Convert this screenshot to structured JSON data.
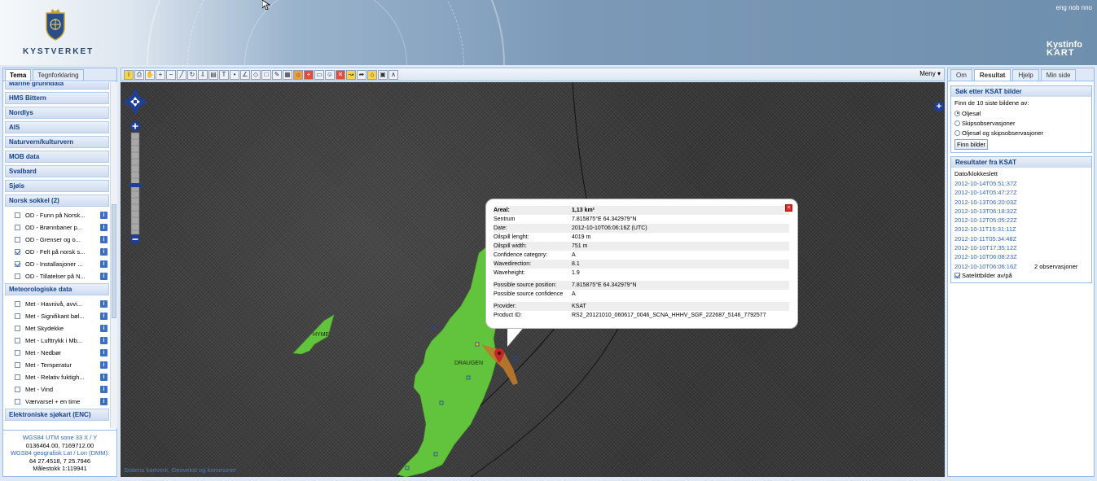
{
  "header": {
    "logo_text": "KYSTVERKET",
    "lang_links": "eng nob nno",
    "brand_line1": "Kystinfo",
    "brand_line2": "KART"
  },
  "left_panel": {
    "tabs": [
      "Tema",
      "Tegnforklaring"
    ],
    "groups": [
      {
        "label": "Marine grunndata",
        "items": []
      },
      {
        "label": "HMS Bittern",
        "items": []
      },
      {
        "label": "Nordlys",
        "items": []
      },
      {
        "label": "AIS",
        "items": []
      },
      {
        "label": "Naturvern/kulturvern",
        "items": []
      },
      {
        "label": "MOB data",
        "items": []
      },
      {
        "label": "Svalbard",
        "items": []
      },
      {
        "label": "Sjøis",
        "items": []
      },
      {
        "label": "Norsk sokkel (2)",
        "items": [
          {
            "label": "OD - Funn på Norsk...",
            "checked": false
          },
          {
            "label": "OD - Brønnbaner p...",
            "checked": false
          },
          {
            "label": "OD - Grenser og o...",
            "checked": false
          },
          {
            "label": "OD - Felt på norsk s...",
            "checked": true
          },
          {
            "label": "OD - Installasjoner ...",
            "checked": true
          },
          {
            "label": "OD - Tillatelser på N...",
            "checked": false
          }
        ]
      },
      {
        "label": "Meteorologiske data",
        "items": [
          {
            "label": "Met - Havnivå, avvi...",
            "checked": false
          },
          {
            "label": "Met - Signifikant bøl...",
            "checked": false
          },
          {
            "label": "Met Skydekke",
            "checked": false
          },
          {
            "label": "Met - Lufttrykk i Mb...",
            "checked": false
          },
          {
            "label": "Met - Nedbør",
            "checked": false
          },
          {
            "label": "Met - Temperatur",
            "checked": false
          },
          {
            "label": "Met - Relativ fuktigh...",
            "checked": false
          },
          {
            "label": "Met - Vind",
            "checked": false
          },
          {
            "label": "Værvarsel + en time",
            "checked": false
          }
        ]
      },
      {
        "label": "Elektroniske sjøkart (ENC)",
        "items": []
      }
    ],
    "coords": {
      "utm_label": "WGS84 UTM sone 33 X / Y",
      "utm_value": "0136464.00, 7169712.00",
      "geo_label": "WGS84 geografisk Lat / Lon (DMM):",
      "geo_value": "64 27.4518, 7 25.7946",
      "scale": "Målestokk 1:119941"
    }
  },
  "toolbar": {
    "meny_label": "Meny"
  },
  "map": {
    "labels": {
      "hyme": "HYME",
      "draugen": "DRAUGEN"
    },
    "credits": "Statens kartverk, Geovekst og kommuner",
    "popup": {
      "rows": [
        {
          "k": "Areal:",
          "v": "1,13 km²"
        },
        {
          "k": "Sentrum",
          "v": "7.815875°E 64.342979°N"
        },
        {
          "k": "Date:",
          "v": "2012-10-10T06:06:16Z (UTC)"
        },
        {
          "k": "Oilspill lenght:",
          "v": "4019 m"
        },
        {
          "k": "Oilspill width:",
          "v": "751 m"
        },
        {
          "k": "Confidence category:",
          "v": "A"
        },
        {
          "k": "Wavedirection:",
          "v": "8.1"
        },
        {
          "k": "Waveheight:",
          "v": "1.9"
        }
      ],
      "rows2": [
        {
          "k": "Possible source position:",
          "v": "7.815875°E 64.342979°N"
        },
        {
          "k": "Possible source confidence",
          "v": "A"
        }
      ],
      "rows3": [
        {
          "k": "Provider:",
          "v": "KSAT"
        },
        {
          "k": "Product ID:",
          "v": "RS2_20121010_060617_0046_SCNA_HHHV_SGF_222687_5146_7792577"
        }
      ]
    }
  },
  "right_panel": {
    "tabs": [
      "Om",
      "Resultat",
      "Hjelp",
      "Min side"
    ],
    "search": {
      "title": "Søk etter KSAT bilder",
      "intro": "Finn de 10 siste bildene av:",
      "options": [
        {
          "label": "Oljesøl",
          "selected": true
        },
        {
          "label": "Skipsobservasjoner",
          "selected": false
        },
        {
          "label": "Oljesøl og skipsobservasjoner",
          "selected": false
        }
      ],
      "button": "Finn bilder"
    },
    "results": {
      "title": "Resultater fra KSAT",
      "header": "Dato/klokkeslett",
      "items": [
        {
          "date": "2012-10-14T05:51:37Z",
          "note": ""
        },
        {
          "date": "2012-10-14T05:47:27Z",
          "note": ""
        },
        {
          "date": "2012-10-13T06:20:03Z",
          "note": ""
        },
        {
          "date": "2012-10-13T06:18:32Z",
          "note": ""
        },
        {
          "date": "2012-10-12T05:05:22Z",
          "note": ""
        },
        {
          "date": "2012-10-11T15:31:11Z",
          "note": ""
        },
        {
          "date": "2012-10-11T05:34:48Z",
          "note": ""
        },
        {
          "date": "2012-10-10T17:35:12Z",
          "note": ""
        },
        {
          "date": "2012-10-10T06:08:23Z",
          "note": ""
        },
        {
          "date": "2012-10-10T06:06:16Z",
          "note": "2 observasjoner"
        }
      ],
      "toggle_label": "Satelittbilder av/på",
      "toggle_checked": true
    }
  }
}
